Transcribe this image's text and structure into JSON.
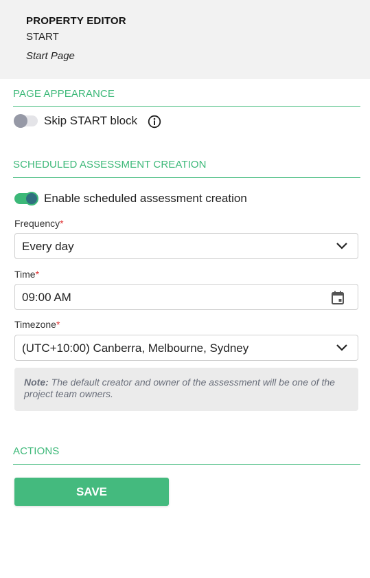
{
  "header": {
    "title": "PROPERTY EDITOR",
    "block_name": "START",
    "page_name": "Start Page"
  },
  "sections": {
    "page_appearance": "PAGE APPEARANCE",
    "scheduled": "SCHEDULED ASSESSMENT CREATION",
    "actions": "ACTIONS"
  },
  "page_appearance": {
    "skip_start": {
      "label": "Skip START block",
      "checked": false
    }
  },
  "scheduled": {
    "enable": {
      "label": "Enable scheduled assessment creation",
      "checked": true
    },
    "frequency": {
      "label": "Frequency",
      "value": "Every day"
    },
    "time": {
      "label": "Time",
      "value": "09:00 AM"
    },
    "timezone": {
      "label": "Timezone",
      "value": "(UTC+10:00) Canberra, Melbourne, Sydney"
    },
    "required_marker": "*",
    "note": {
      "prefix": "Note:",
      "text": " The default creator and owner of the assessment will be one of the project team owners."
    }
  },
  "actions": {
    "save_label": "SAVE"
  },
  "colors": {
    "accent": "#3cb878",
    "button": "#44ba7e",
    "required": "#e03131",
    "header_bg": "#f2f2f2",
    "note_bg": "#ebebeb"
  },
  "icons": {
    "info": "info-icon",
    "chevron": "chevron-down-icon",
    "calendar": "calendar-icon"
  }
}
